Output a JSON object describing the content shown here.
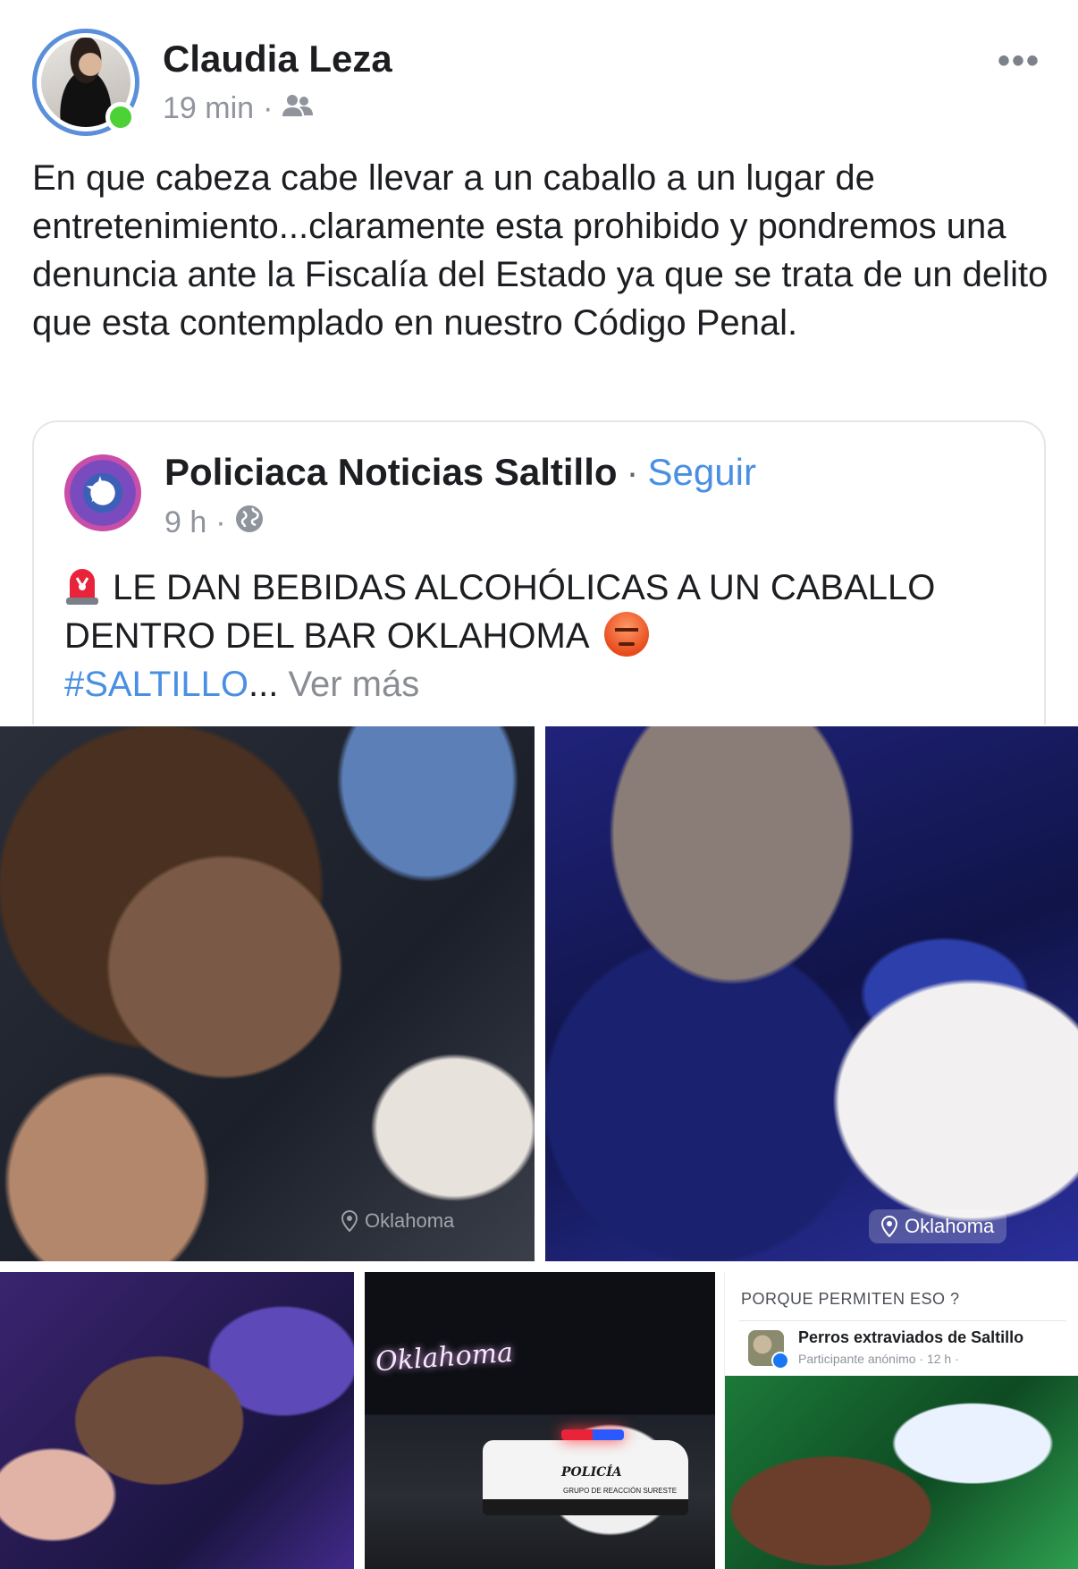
{
  "post": {
    "author": "Claudia Leza",
    "time": "19 min",
    "meta_separator": "·",
    "audience_icon": "friends-icon",
    "more_label": "•••",
    "text": "En que cabeza cabe llevar a un caballo a un lugar de entretenimiento...claramente esta prohibido y pondremos una denuncia ante la Fiscalía del Estado ya que se trata de un delito que esta contemplado en nuestro Código Penal."
  },
  "shared": {
    "page_name": "Policiaca Noticias Saltillo",
    "separator": "·",
    "follow_label": "Seguir",
    "time": "9 h",
    "meta_separator": "·",
    "audience_icon": "globe-icon",
    "emoji_start": "siren-emoji",
    "headline": "LE DAN BEBIDAS ALCOHÓLICAS A UN CABALLO DENTRO DEL BAR OKLAHOMA",
    "emoji_end": "angry-face-emoji",
    "hashtag": "#SALTILLO",
    "ellipsis": "...",
    "see_more": "Ver más"
  },
  "photos": {
    "location_tag_1": "Oklahoma",
    "location_tag_2": "Oklahoma",
    "neon_sign": "Oklahoma",
    "patrol_label": "POLICÍA",
    "patrol_sub": "GRUPO DE REACCIÓN SURESTE",
    "question": "PORQUE PERMITEN ESO ?",
    "group_name": "Perros extraviados de Saltillo",
    "group_meta": "Participante anónimo · 12 h ·"
  },
  "colors": {
    "link_blue": "#4a90e2",
    "online_green": "#4cd137",
    "avatar_ring": "#5b8fd9"
  }
}
